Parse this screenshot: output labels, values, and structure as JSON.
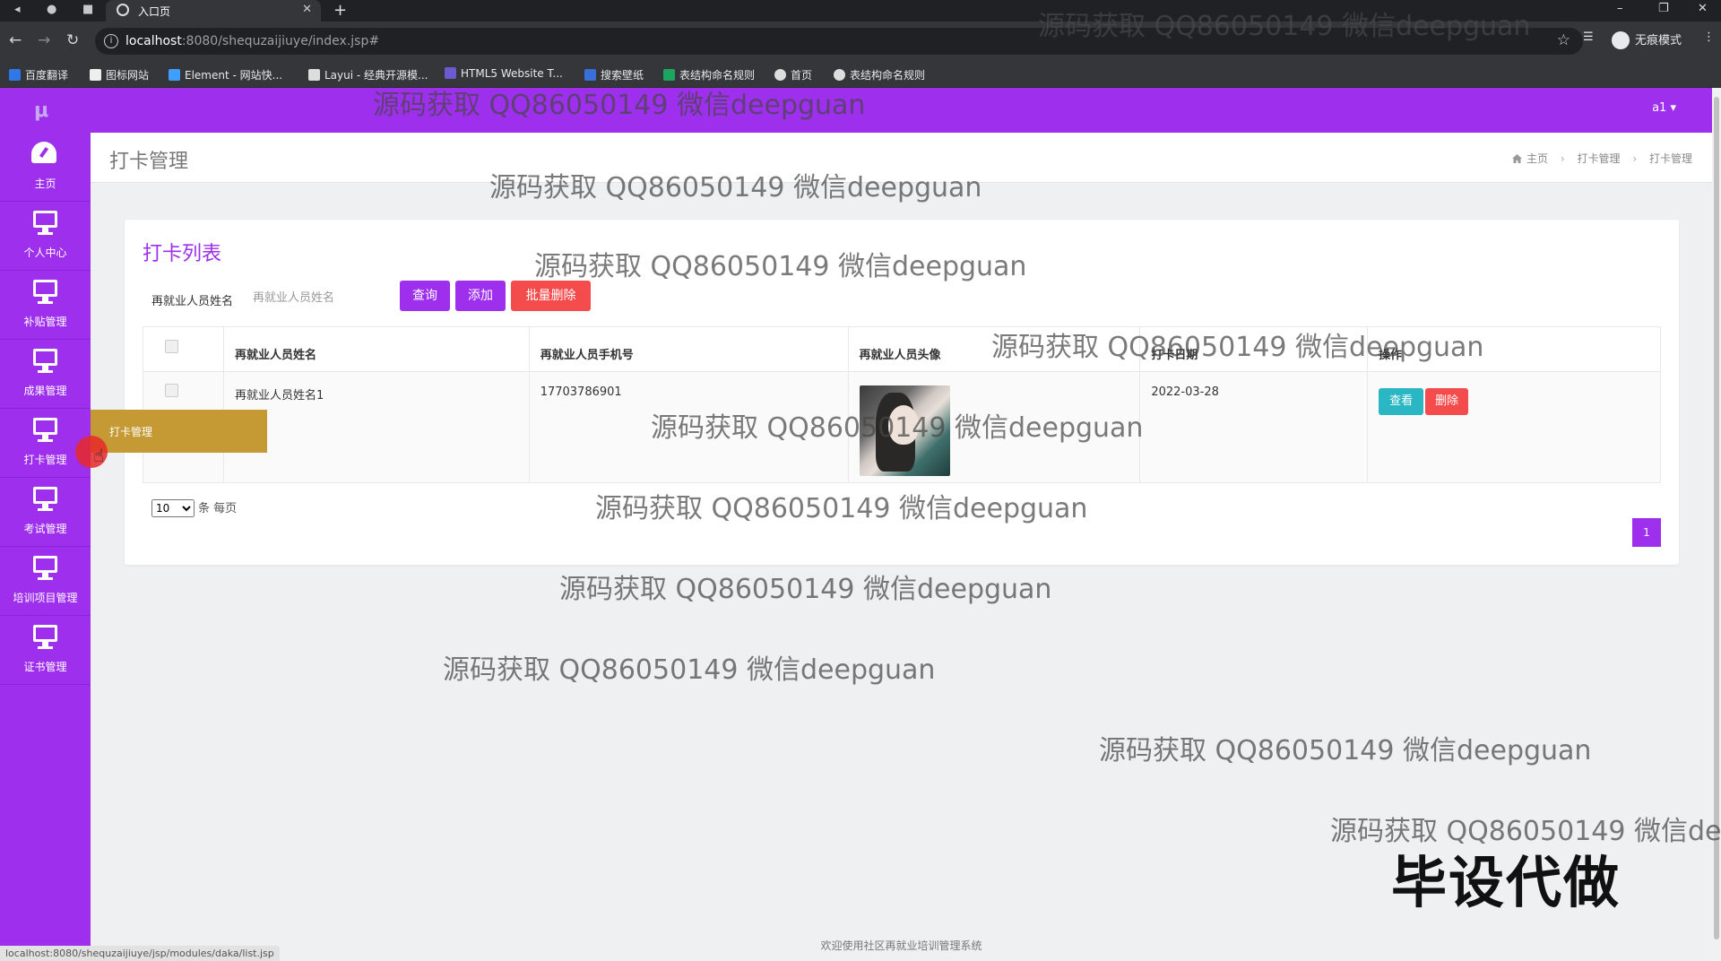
{
  "browser": {
    "tab_title": "入口页",
    "url_host": "localhost",
    "url_path": ":8080/shequzaijiuye/index.jsp#",
    "incognito_label": "无痕模式",
    "bookmarks": [
      "百度翻译",
      "图标网站",
      "Element - 网站快...",
      "Layui - 经典开源模...",
      "HTML5 Website T...",
      "搜索壁纸",
      "表结构命名规则",
      "首页",
      "表结构命名规则"
    ],
    "status_url": "localhost:8080/shequzaijiuye/jsp/modules/daka/list.jsp"
  },
  "app": {
    "logo": "μ",
    "user": "a1 ▾",
    "sidebar": [
      {
        "label": "主页",
        "icon": "dashboard-icon"
      },
      {
        "label": "个人中心",
        "icon": "monitor-icon"
      },
      {
        "label": "补贴管理",
        "icon": "monitor-icon"
      },
      {
        "label": "成果管理",
        "icon": "monitor-icon"
      },
      {
        "label": "打卡管理",
        "icon": "monitor-icon"
      },
      {
        "label": "考试管理",
        "icon": "monitor-icon"
      },
      {
        "label": "培训项目管理",
        "icon": "monitor-icon"
      },
      {
        "label": "证书管理",
        "icon": "monitor-icon"
      }
    ],
    "tooltip": "打卡管理",
    "page_title": "打卡管理",
    "breadcrumb": [
      "主页",
      "打卡管理",
      "打卡管理"
    ],
    "card_title": "打卡列表",
    "search": {
      "label": "再就业人员姓名",
      "placeholder": "再就业人员姓名"
    },
    "buttons": {
      "query": "查询",
      "add": "添加",
      "batch_delete": "批量删除"
    },
    "table": {
      "headers": [
        "再就业人员姓名",
        "再就业人员手机号",
        "再就业人员头像",
        "打卡日期",
        "操作"
      ],
      "rows": [
        {
          "name": "再就业人员姓名1",
          "phone": "17703786901",
          "date": "2022-03-28",
          "view": "查看",
          "delete": "删除"
        }
      ]
    },
    "pagination": {
      "page_size": "10",
      "per_page_label": "条 每页",
      "current_page": "1"
    },
    "footer": "欢迎使用社区再就业培训管理系统"
  },
  "watermark": "源码获取 QQ86050149 微信deepguan",
  "stamp_text": "毕设代做",
  "colors": {
    "brand": "#9d2fed",
    "danger": "#f44c4c",
    "info": "#2bb6c4",
    "tooltip": "#c59a35"
  }
}
